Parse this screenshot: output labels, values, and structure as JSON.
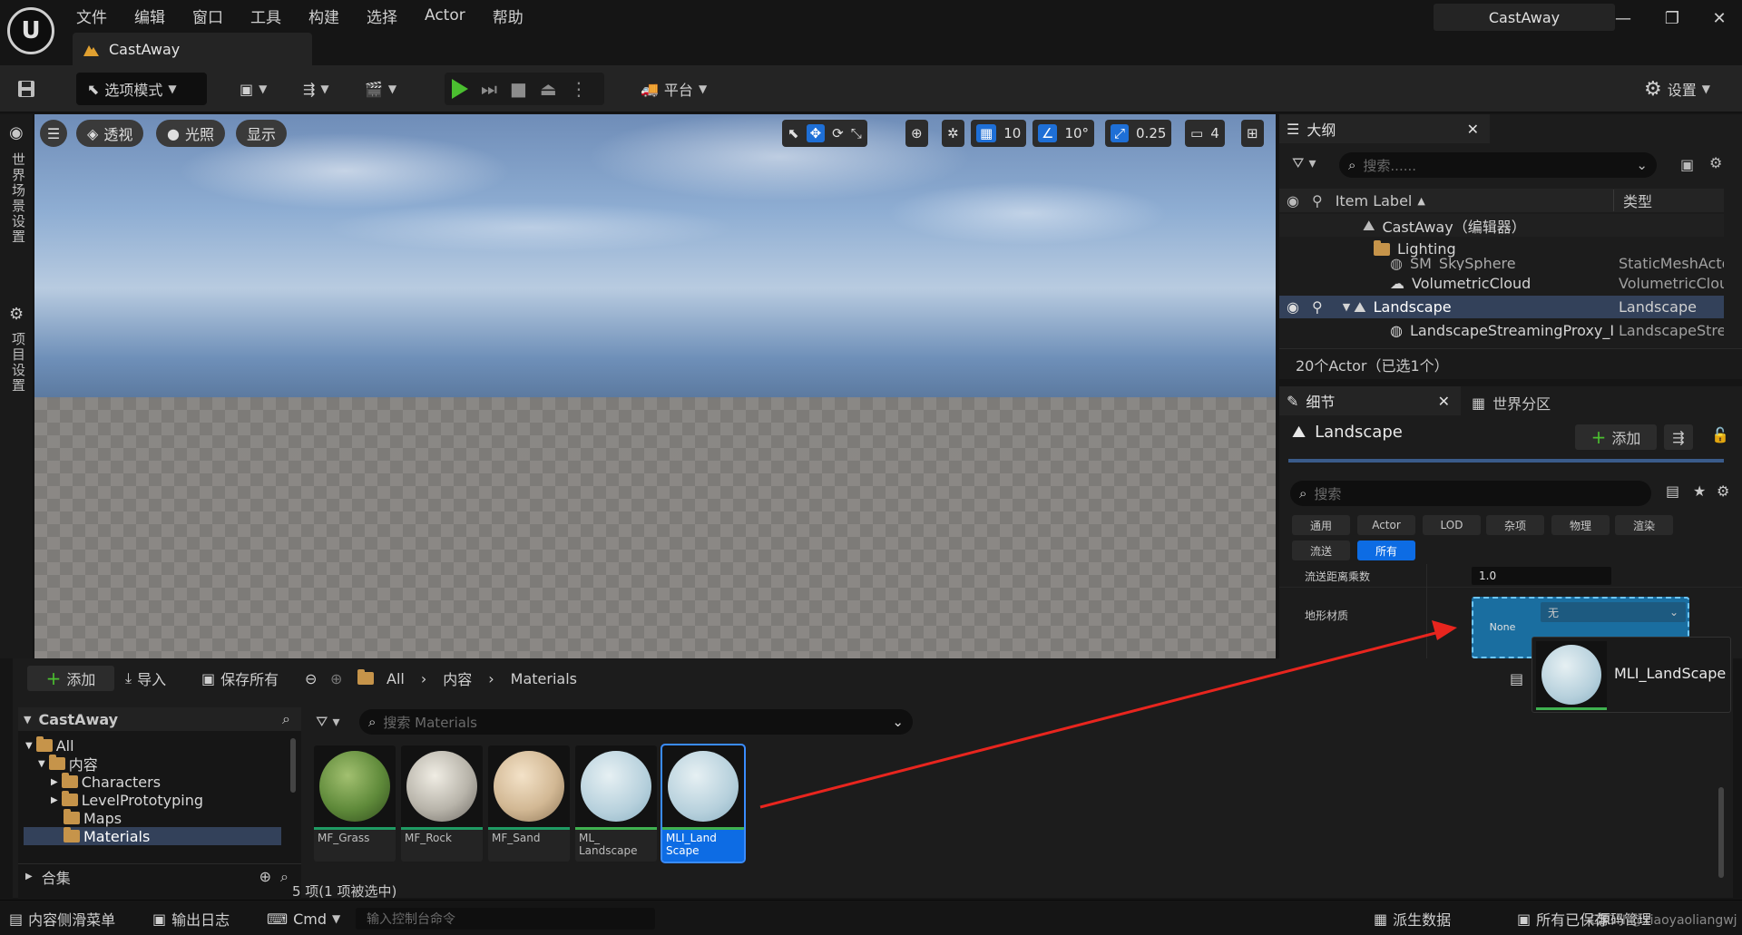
{
  "window": {
    "menus": [
      "文件",
      "编辑",
      "窗口",
      "工具",
      "构建",
      "选择",
      "Actor",
      "帮助"
    ],
    "level_tab": "CastAway",
    "project_name": "CastAway",
    "controls": {
      "minimize": "—",
      "maximize": "❐",
      "close": "✕"
    }
  },
  "toolbar": {
    "mode_label": "选项模式",
    "platform_label": "平台",
    "settings_label": "设置"
  },
  "left_strip": {
    "world_settings": "世界场景设置",
    "project_settings": "项目设置"
  },
  "viewport": {
    "perspective": "透视",
    "lighting": "光照",
    "show": "显示",
    "grid_snap": "10",
    "rotate_snap": "10°",
    "scale_snap": "0.25",
    "camera_speed": "4"
  },
  "outliner": {
    "tab_label": "大纲",
    "search_placeholder": "搜索......",
    "col_label": "Item Label",
    "col_type": "类型",
    "rows": [
      {
        "label": "CastAway（编辑器）",
        "type": ""
      },
      {
        "label": "Lighting",
        "type": ""
      },
      {
        "label": "SM_SkySphere",
        "type": "StaticMeshActor"
      },
      {
        "label": "VolumetricCloud",
        "type": "VolumetricCloud"
      },
      {
        "label": "Landscape",
        "type": "Landscape"
      },
      {
        "label": "LandscapeStreamingProxy_I",
        "type": "LandscapeStreamingProxy"
      }
    ],
    "footer": "20个Actor（已选1个）"
  },
  "details": {
    "tab_label": "细节",
    "tab_world_partition": "世界分区",
    "actor_name": "Landscape",
    "add_label": "添加",
    "search_placeholder": "搜索",
    "categories": [
      "通用",
      "Actor",
      "LOD",
      "杂项",
      "物理",
      "渲染",
      "流送",
      "所有"
    ],
    "prop1_label": "流送距离乘数",
    "prop1_value": "1.0",
    "prop2_label": "地形材质",
    "prop2_thumb": "None",
    "prop2_value": "无",
    "drag_tooltip": "MLI_LandScape"
  },
  "content_browser": {
    "add_label": "添加",
    "import_label": "导入",
    "save_all_label": "保存所有",
    "breadcrumb": [
      "All",
      "内容",
      "Materials"
    ],
    "tree_root": "CastAway",
    "tree": [
      "All",
      "内容",
      "Characters",
      "LevelPrototyping",
      "Maps",
      "Materials"
    ],
    "collections": "合集",
    "search_placeholder": "搜索 Materials",
    "assets": [
      {
        "name": "MF_Grass",
        "bar_color": "#1f9b63",
        "selected": false
      },
      {
        "name": "MF_Rock",
        "bar_color": "#1f9b63",
        "selected": false
      },
      {
        "name": "MF_Sand",
        "bar_color": "#1f9b63",
        "selected": false
      },
      {
        "name": "ML_ Landscape",
        "bar_color": "#3fb150",
        "selected": false
      },
      {
        "name": "MLI_Land Scape",
        "bar_color": "#3fb150",
        "selected": true
      }
    ],
    "status": "5 项(1 项被选中)"
  },
  "statusbar": {
    "content_drawer": "内容侧滑菜单",
    "output_log": "输出日志",
    "cmd": "Cmd",
    "console_placeholder": "输入控制台命令",
    "derived_data": "派生数据",
    "source_control": "所有已保存",
    "watermark": "CSDN @xiaoyaoliangwj",
    "revision": "源码管理"
  },
  "colors": {
    "accent_blue": "#0d6ce4",
    "play_green": "#4bbf30",
    "arrow_red": "#e8251e"
  }
}
